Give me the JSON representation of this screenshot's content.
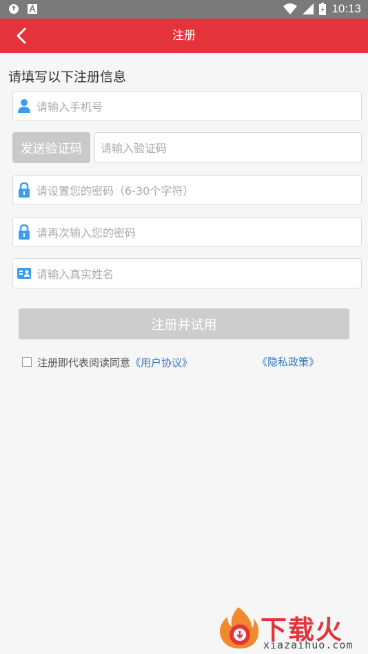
{
  "status_bar": {
    "time": "10:13"
  },
  "app_bar": {
    "title": "注册"
  },
  "form": {
    "heading": "请填写以下注册信息",
    "phone_placeholder": "请输入手机号",
    "send_code_label": "发送验证码",
    "code_placeholder": "请输入验证码",
    "password_placeholder": "请设置您的密码（6-30个字符）",
    "confirm_placeholder": "请再次输入您的密码",
    "name_placeholder": "请输入真实姓名",
    "submit_label": "注册并试用"
  },
  "agreement": {
    "prefix": "注册即代表阅读同意",
    "user_agreement": "《用户协议》",
    "privacy_policy": "《隐私政策》"
  },
  "watermark": {
    "brand": "下载火",
    "domain": "xiazaihuo.com"
  },
  "colors": {
    "app_bar": "#e4333a",
    "link": "#3478c6",
    "icon_blue": "#3a9df2",
    "disabled_button": "#cdcdcd"
  }
}
